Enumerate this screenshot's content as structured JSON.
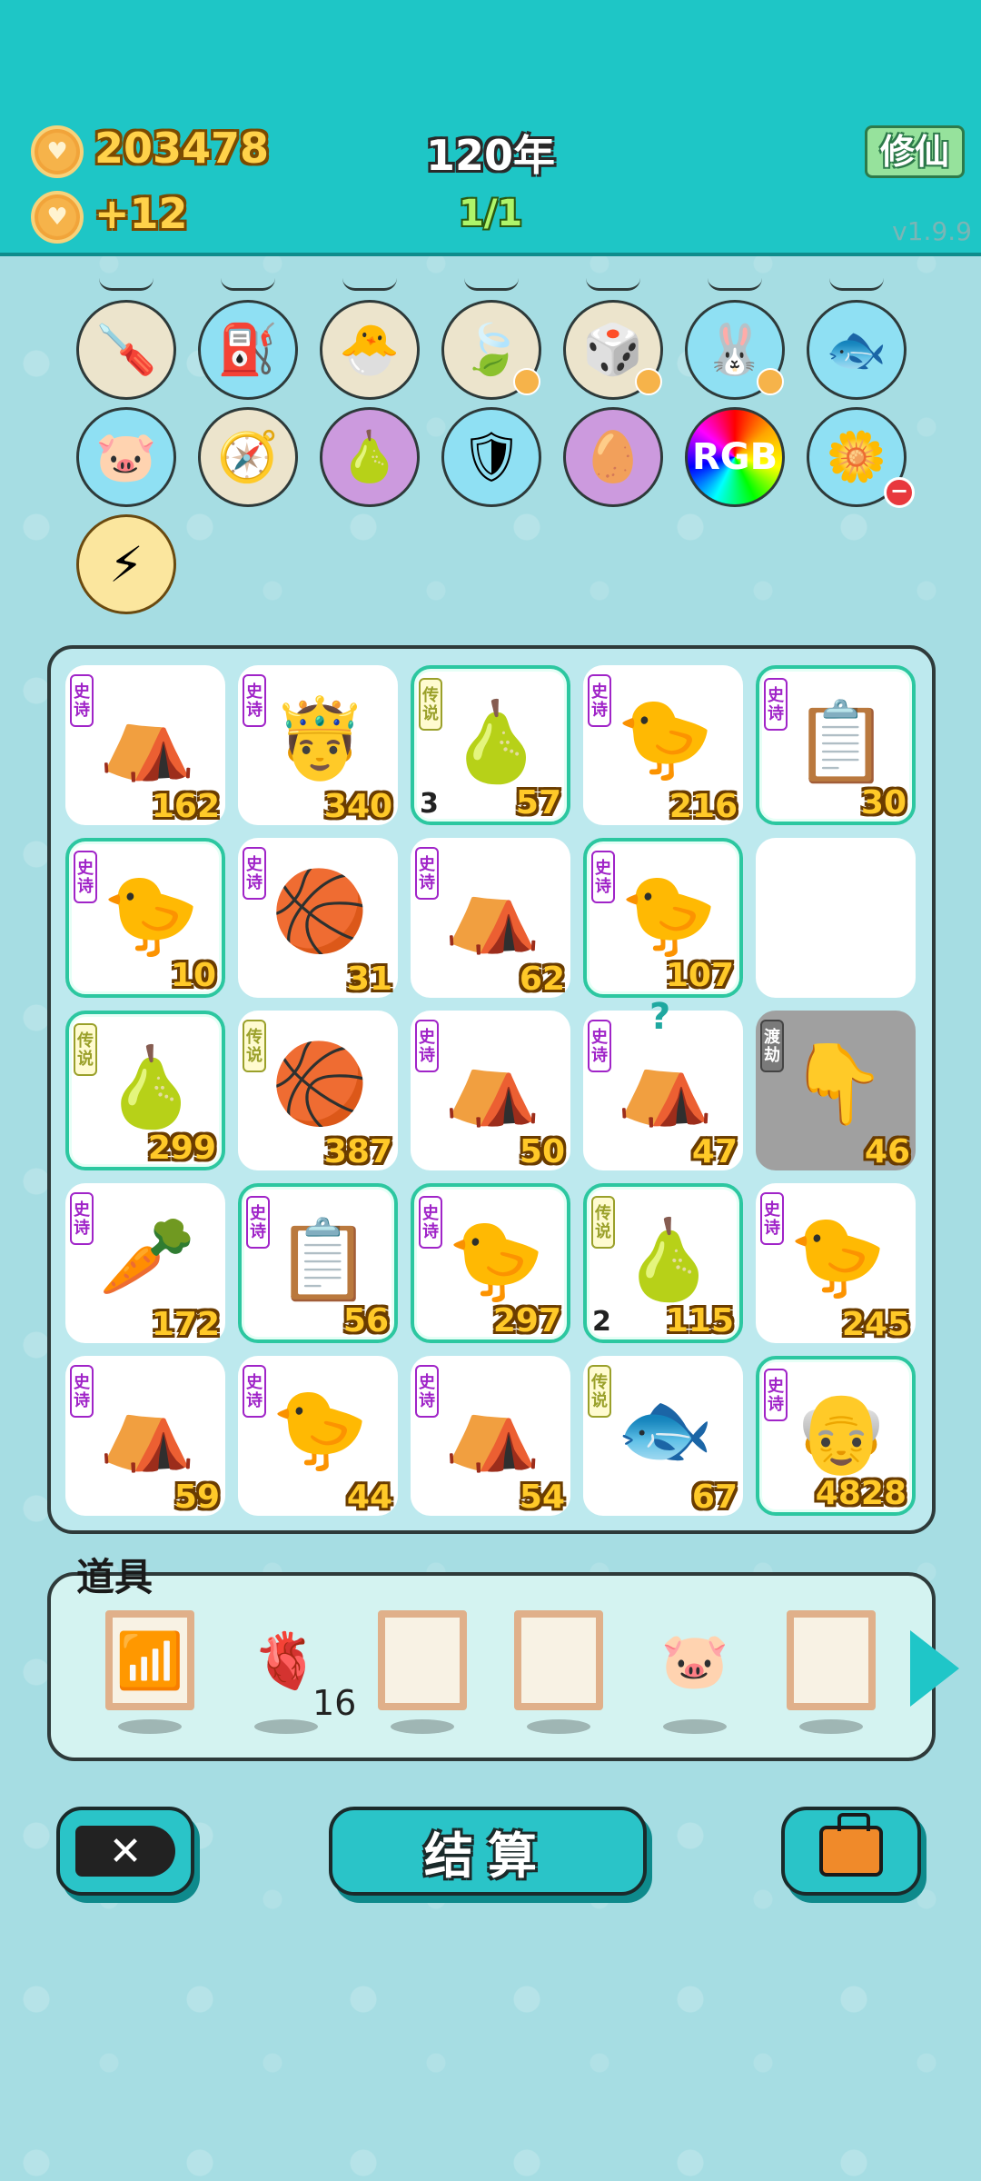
{
  "header": {
    "coins": "203478",
    "income": "+12",
    "year": "120年",
    "round": "1/1",
    "mode_button": "修仙",
    "version": "v1.9.9"
  },
  "relics": [
    {
      "icon": "🪛",
      "name": "screwdriver-icon",
      "style": "beige"
    },
    {
      "icon": "⛽",
      "name": "pump-icon",
      "style": "blue"
    },
    {
      "icon": "🐣",
      "name": "chick-egg-icon",
      "style": "beige"
    },
    {
      "icon": "🍃",
      "name": "leaf-icon",
      "style": "beige",
      "coin": true
    },
    {
      "icon": "🎲",
      "name": "dice-icon",
      "style": "beige",
      "coin": true
    },
    {
      "icon": "🐰",
      "name": "rabbit-icon",
      "style": "blue",
      "coin": true
    },
    {
      "icon": "🐟",
      "name": "fishbowl-icon",
      "style": "blue"
    },
    {
      "icon": "🐷",
      "name": "piggy-bank-icon",
      "style": "blue"
    },
    {
      "icon": "🧭",
      "name": "compass-icon",
      "style": "beige"
    },
    {
      "icon": "🍐",
      "name": "pomelo-icon",
      "style": "purple"
    },
    {
      "icon": "🛡",
      "name": "shield-wrench-icon",
      "style": "blue"
    },
    {
      "icon": "🥚",
      "name": "egg-icon",
      "style": "purple"
    },
    {
      "icon": "RGB",
      "name": "rgb-icon",
      "style": "rgb"
    },
    {
      "icon": "🌼",
      "name": "flower-pot-icon",
      "style": "blue",
      "minus": true
    },
    {
      "icon": "⚡",
      "name": "lightning-icon",
      "style": "gold"
    }
  ],
  "board": [
    {
      "tag": "史诗",
      "tagType": "epic",
      "icon": "⛺",
      "name": "rabbit-tent",
      "value": "162",
      "rare": false
    },
    {
      "tag": "史诗",
      "tagType": "epic",
      "icon": "🤴",
      "name": "king-sunglasses",
      "value": "340",
      "rare": false
    },
    {
      "tag": "传说",
      "tagType": "legend",
      "icon": "🍐",
      "name": "pomelo",
      "value": "57",
      "count": "3",
      "rare": true
    },
    {
      "tag": "史诗",
      "tagType": "epic",
      "icon": "🐤",
      "name": "chick-hair",
      "value": "216",
      "rare": false
    },
    {
      "tag": "史诗",
      "tagType": "epic",
      "icon": "📋",
      "name": "ctrl-c-v-card",
      "value": "30",
      "rare": true
    },
    {
      "tag": "史诗",
      "tagType": "epic",
      "icon": "🐤",
      "name": "chick-hair",
      "value": "10",
      "rare": true
    },
    {
      "tag": "史诗",
      "tagType": "epic",
      "icon": "🏀",
      "name": "chick-basketball",
      "value": "31",
      "rare": false
    },
    {
      "tag": "史诗",
      "tagType": "epic",
      "icon": "⛺",
      "name": "rabbit-tent",
      "value": "62",
      "rare": false
    },
    {
      "tag": "史诗",
      "tagType": "epic",
      "icon": "🐤",
      "name": "chick-hair",
      "value": "107",
      "rare": true
    },
    {
      "tag": "",
      "tagType": "",
      "icon": "",
      "name": "empty-cell",
      "value": "",
      "rare": false
    },
    {
      "tag": "传说",
      "tagType": "legend",
      "icon": "🍐",
      "name": "pomelo",
      "value": "299",
      "rare": true
    },
    {
      "tag": "传说",
      "tagType": "legend",
      "icon": "🏀",
      "name": "cat-basketball",
      "value": "387",
      "rare": false
    },
    {
      "tag": "史诗",
      "tagType": "epic",
      "icon": "⛺",
      "name": "rabbit-tent",
      "value": "50",
      "rare": false
    },
    {
      "tag": "史诗",
      "tagType": "epic",
      "icon": "⛺",
      "name": "rabbit-tent",
      "value": "47",
      "rare": false
    },
    {
      "tag": "渡劫",
      "tagType": "dj",
      "icon": "👇",
      "name": "pointing-hand",
      "value": "46",
      "rare": false,
      "gray": true
    },
    {
      "tag": "史诗",
      "tagType": "epic",
      "icon": "🥕",
      "name": "carrot",
      "value": "172",
      "rare": false
    },
    {
      "tag": "史诗",
      "tagType": "epic",
      "icon": "📋",
      "name": "ctrl-c-v-card",
      "value": "56",
      "rare": true
    },
    {
      "tag": "史诗",
      "tagType": "epic",
      "icon": "🐤",
      "name": "chick-hair",
      "value": "297",
      "rare": true
    },
    {
      "tag": "传说",
      "tagType": "legend",
      "icon": "🍐",
      "name": "pomelo-sparkle",
      "value": "115",
      "count": "2",
      "rare": true
    },
    {
      "tag": "史诗",
      "tagType": "epic",
      "icon": "🐤",
      "name": "chick-hair",
      "value": "245",
      "rare": false
    },
    {
      "tag": "史诗",
      "tagType": "epic",
      "icon": "⛺",
      "name": "rabbit-tent",
      "value": "59",
      "rare": false
    },
    {
      "tag": "史诗",
      "tagType": "epic",
      "icon": "🐤",
      "name": "chick-hair",
      "value": "44",
      "rare": false
    },
    {
      "tag": "史诗",
      "tagType": "epic",
      "icon": "⛺",
      "name": "rabbit-tent",
      "value": "54",
      "rare": false
    },
    {
      "tag": "传说",
      "tagType": "legend",
      "icon": "🐟",
      "name": "koi-fish",
      "value": "67",
      "rare": false
    },
    {
      "tag": "史诗",
      "tagType": "epic",
      "icon": "👴",
      "name": "grandpa-spiral",
      "value": "4828",
      "rare": true
    }
  ],
  "qmark": "?",
  "items": {
    "label": "道具",
    "slots": [
      {
        "icon": "📶",
        "name": "wifi-item-icon",
        "frame": true
      },
      {
        "icon": "🫀",
        "name": "liver-item-icon",
        "frame": false,
        "count": "16"
      },
      {
        "icon": "",
        "name": "empty-item-slot",
        "frame": true
      },
      {
        "icon": "",
        "name": "empty-item-slot",
        "frame": true
      },
      {
        "icon": "🐷",
        "name": "piggy-item-icon",
        "frame": false
      },
      {
        "icon": "",
        "name": "empty-item-slot",
        "frame": true
      }
    ]
  },
  "buttons": {
    "settle": "结算"
  }
}
